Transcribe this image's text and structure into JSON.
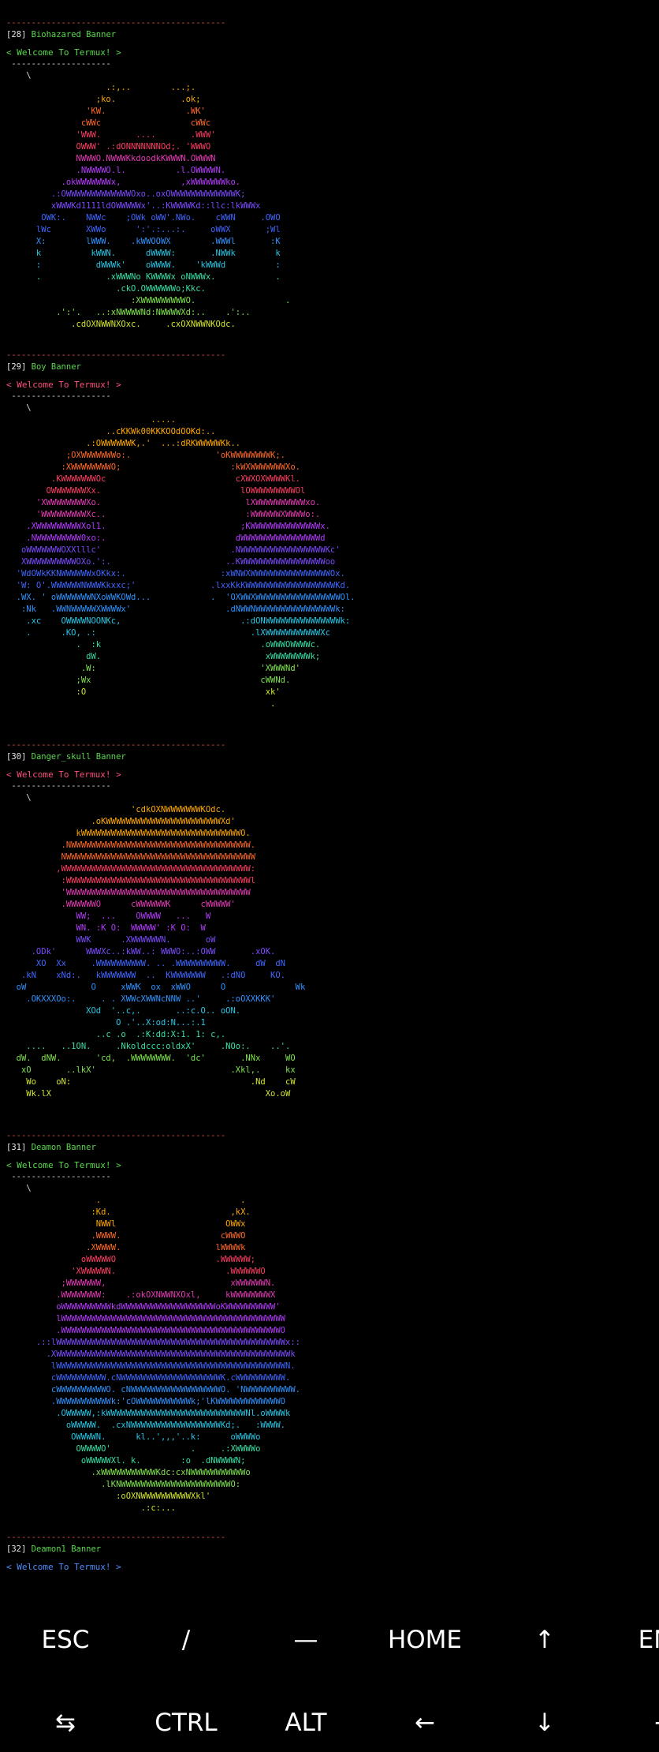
{
  "colors": {
    "separator": "#e05545",
    "title_name": "#57d94a",
    "rainbow": [
      "#ffa800",
      "#ff6a2a",
      "#ff3d63",
      "#e53bb5",
      "#b43bff",
      "#7b4bff",
      "#3f66ff",
      "#2f93ff",
      "#27c7e5",
      "#35e0a6",
      "#7ee44d",
      "#d3e52a"
    ]
  },
  "separator": "--------------------------------------------",
  "banners": [
    {
      "num": "[28]",
      "name": "Biohazared Banner",
      "welcome": "< Welcome To Termux! >",
      "dash": " --------------------",
      "tail": "    \\",
      "art": [
        "                    .:,..        ...;.",
        "                  ;ko.             .ok;",
        "                'KW.                .WK'",
        "               cWWc                  cWWc",
        "              'WWW.       ....       .WWW'",
        "              OWWW' .:dONNNNNNNOd;. 'WWWO",
        "              NWWWO.NWWWKkdoodkKWWWN.OWWWN",
        "              .NWWWWO.l.          .l.OWWWWN.",
        "           .okWWWWWWWx,            ,xWWWWWWWko.",
        "         .:OWWWWWWWWWWWWWOxo..oxOWWWWWWWWWWWWWK;",
        "         xWWWKd1111ldOWWWWWx'..:KWWWWKd::llc:lkWWWx",
        "       OWK:.    NWWc    ;OWk oWW'.NWo.    cWWN     .OWO",
        "      lWc       XWWo      ':'.:...:.     oWWX       ;Wl",
        "      X:        lWWW.    .kWWOOWX        .WWWl       :K",
        "      k          kWWN.      dWWWW:       .NWWk        k",
        "      :           dWWWk'    oWWWW.    'kWWWd          :",
        "      .             .xWWWNo KWWWWx oNWWWx.            .",
        "                      .ckO.OWWWWWWo;Kkc.",
        "                         :XWWWWWWWWWO.                  .",
        "          .':'.   ..:xNWWWWNd:NWWWWXd:..    .':..",
        "             .cdOXNWWNXOxc.     .cxOXNWWNKOdc."
      ]
    },
    {
      "num": "[29]",
      "name": "Boy Banner",
      "welcome": "< Welcome To Termux! >",
      "dash": " --------------------",
      "tail": "    \\",
      "art": [
        "                             .....",
        "                    ..cKKWk00KKKOOdOOKd:..",
        "                .:OWWWWWWK,.'  ...:dRKWWWWWKk..",
        "            ;OXWWWWWWWo:.                 'oKWWWWWWWWK;.",
        "           :XWWWWWWWWO;                      :kWXWWWWWWWXo.",
        "         .KWWWWWWWOc                          cXWXOXWWWWKl.",
        "        OWWWWWWWXx.                            lOWWWWWWWWWOl",
        "      'XWWWWWWWWXo.                             lXWWWWWWWWWWxo.",
        "      'WWWWWWWWWXc..                            :WWWWWWXWWWWo:.",
        "    .XWWWWWWWWWXol1.                           ;KWWWWWWWWWWWWWWx.",
        "    .NWWWWWWWWW0xo:.                          dWWWWWWWWWWWWWWWWd",
        "   oWWWWWWWOXXlllc'                          .NWWWWWWWWWWWWWWWWWKc'",
        "   XWWWWWWWWWWOXo.':.                       ..KWWWWWWWWWWWWWWWWWoo",
        "  'WdOWkKKNWWWWWWxOKkx:.                   :xWNWXWWWWWWWWWWWWWWWWOx.",
        "  'W: O'.WWWWWWNWWWKkxxc;'               .lxxKkKWWWWWWWWWWWWWWWWWWKd.",
        "  .WX. ' oWWWWWWWNXoWWKOWd...            .  'OXWWXWWWWWWWWWWWWWWWWWOl.",
        "   :Nk   .WWNWWWWWXWWWWx'                   .dNWWNWWWWWWWWWWWWWWWWk:",
        "    .xc    OWWWWNOONKc,                        .:dONWWWWWWWWWWWWWWWk:",
        "    .      .KO, .:                               .lXWWWWWWWWWWWXc",
        "              .  :k                                .oWWWOWWWWc.",
        "                dW.                                 xWWWWWWWWk;",
        "               .W:                                 'XWWWNd'",
        "              ;Wx                                  cWWNd.",
        "              :O                                    xk'",
        "                                                     ."
      ]
    },
    {
      "num": "[30]",
      "name": "Danger_skull Banner",
      "welcome": "< Welcome To Termux! >",
      "dash": " --------------------",
      "tail": "    \\",
      "art": [
        "                         'cdkOXNWWWWWWWKOdc.",
        "                 .oKWWWWWWWWWWWWWWWWWWWWWWWXd'",
        "              kWWWWWWWWWWWWWWWWWWWWWWWWWWWWWWWWO.",
        "           .NWWWWWWWWWWWWWWWWWWWWWWWWWWWWWWWWWWWW.",
        "           NWWWWWWWWWWWWWWWWWWWWWWWWWWWWWWWWWWWWWW",
        "          ,WWWWWWWWWWWWWWWWWWWWWWWWWWWWWWWWWWWWWW:",
        "           :WWWWWWWWWWWWWWWWWWWWWWWWWWWWWWWWWWWWWl",
        "           'WWWWWWWWWWWWWWWWWWWWWWWWWWWWWWWWWWWWW",
        "           .WWWWWWO      cWWWWWWK      cWWWWW'",
        "              WW;  ...    OWWWW   ...   W",
        "              WN. :K O:  WWWWW' :K O:  W",
        "              WWK      .XWWWWWWN.       oW",
        "     .ODk'      WWWXc..:kWW..: WWWO:..:OWW       .xOK.",
        "      XO  Xx     .WWWWWWWWWW. .. .WWWWWWWWWW.     dW  dN",
        "   .kN    xNd:.   kWWWWWWW  ..  KWWWWWWW   .:dNO     KO.",
        "  oW             O     xWWK  ox  xWWO      O              Wk",
        "    .OKXXXOo:.     . . XWWcXWWNcNNW ..'     .:oOXXKKK'",
        "                XOd  '..c,.       ..:c.O.. oON.",
        "                      O .'..X:od:N...:.1",
        "                  ..c .o  .:K:dd:X:1. 1: c,.",
        "    ....   ..1ON.     .Nkoldccc:oldxX'     .NOo:.    ..'.",
        "  dW.  dNW.       'cd,  .WWWWWWWW.  'dc'       .NNx     WO",
        "   xO       ..lkX'                           .Xkl,.     kx",
        "    Wo    oN:                                    .Nd    cW",
        "    Wk.lX                                           Xo.oW"
      ]
    },
    {
      "num": "[31]",
      "name": "Deamon Banner",
      "welcome": "< Welcome To Termux! >",
      "dash": " --------------------",
      "tail": "    \\",
      "art": [
        "                  .                            .",
        "                 :Kd.                        ,kX.",
        "                  NWWl                      OWWx",
        "                 .WWWW.                    cWWWO",
        "                .XWWWW.                   lWWWWk",
        "               oWWWWWO                    .WWWWWW;",
        "             'XWWWWWN.                      .WWWWWWO",
        "           ;WWWWWWW,                         xWWWWWWN.",
        "          .WWWWWWWW:    .:okOXNWWNXOxl,     kWWWWWWWWX",
        "          oWWWWWWWWWWkdWWWWWWWWWWWWWWWWWWWoKWWWWWWWWWW'",
        "          lWWWWWWWWWWWWWWWWWWWWWWWWWWWWWWWWWWWWWWWWWWWWW",
        "          .WWWWWWWWWWWWWWWWWWWWWWWWWWWWWWWWWWWWWWWWWWWWO",
        "      .::lWWWWWWWWWWWWWWWWWWWWWWWWWWWWWWWWWWWWWWWWWWWWWWx::",
        "        .XWWWWWWWWWWWWWWWWWWWWWWWWWWWWWWWWWWWWWWWWWWWWWWWk",
        "         lWWWWWWWWWWWWWWWWWWWWWWWWWWWWWWWWWWWWWWWWWWWWWWN.",
        "         cWWWWWWWWWW.cNWWWWWWWWWWWWWWWWWWWWK.cWWWWWWWWWW.",
        "         cWWWWWWWWWWO. cNWWWWWWWWWWWWWWWWWWO. 'NWWWWWWWWWW.",
        "         .WWWWWWWWWWWk:'cOWWWWWWWWWWWk;'lKWWWWWWWWWWWWWO",
        "          .OWWWWW,:kWWWWWWWWWWWWWWWWWWWWWWWWWWWWNl.oWWWWk",
        "            oWWWWW.  .cxNWWWWWWWWWWWWWWWWWWKd;.   :WWWW.",
        "             OWWWWN.      kl..',,,'..k:      oWWWWo",
        "              OWWWWO'                .     .:XWWWWo",
        "               oWWWWWXl. k.        :o  .dNWWWWN;",
        "                 .xWWWWWWWWWWWKdc:cxNWWWWWWWWWWWo",
        "                   .lKNWWWWWWWWWWWWWWWWWWWWWWO:",
        "                      :oOXNWWWWWWWWWWXkl'",
        "                           .:c:..."
      ]
    },
    {
      "num": "[32]",
      "name": "Deamon1 Banner",
      "welcome": "< Welcome To Termux! >",
      "dash": "",
      "tail": "",
      "art": []
    }
  ],
  "extra_keys": {
    "row1": [
      "ESC",
      "/",
      "—",
      "HOME",
      "↑",
      "END"
    ],
    "row2": [
      "⇆",
      "CTRL",
      "ALT",
      "←",
      "↓",
      "→"
    ]
  }
}
